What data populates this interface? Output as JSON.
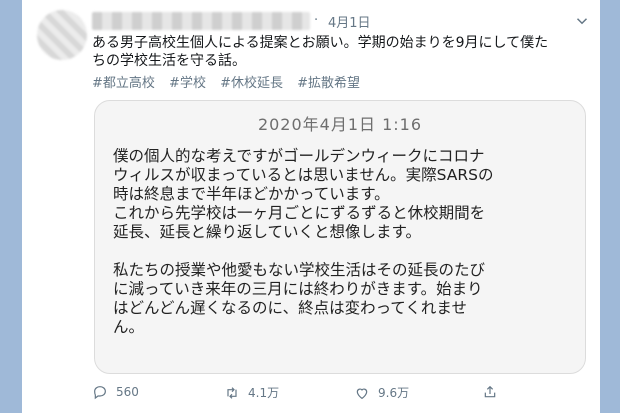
{
  "tweet": {
    "date": "4月1日",
    "text_line1": "ある男子高校生個人による提案とお願い。学期の始まりを9月にして僕た",
    "text_line2": "ちの学校生活を守る話。",
    "hashtags": [
      "#都立高校",
      "#学校",
      "#休校延長",
      "#拡散希望"
    ]
  },
  "quote_image": {
    "timestamp": "2020年4月1日 1:16",
    "lines": [
      "僕の個人的な考えですがゴールデンウィークにコロナ",
      "ウィルスが収まっているとは思いません。実際SARSの",
      "時は終息まで半年ほどかかっています。",
      "これから先学校は一ヶ月ごとにずるずると休校期間を",
      "延長、延長と繰り返していくと想像します。",
      "",
      "私たちの授業や他愛もない学校生活はその延長のたび",
      "に減っていき来年の三月には終わりがきます。始まり",
      "はどんどん遅くなるのに、終点は変わってくれませ",
      "ん。"
    ]
  },
  "actions": {
    "replies": "560",
    "retweets": "4.1万",
    "likes": "9.6万"
  }
}
